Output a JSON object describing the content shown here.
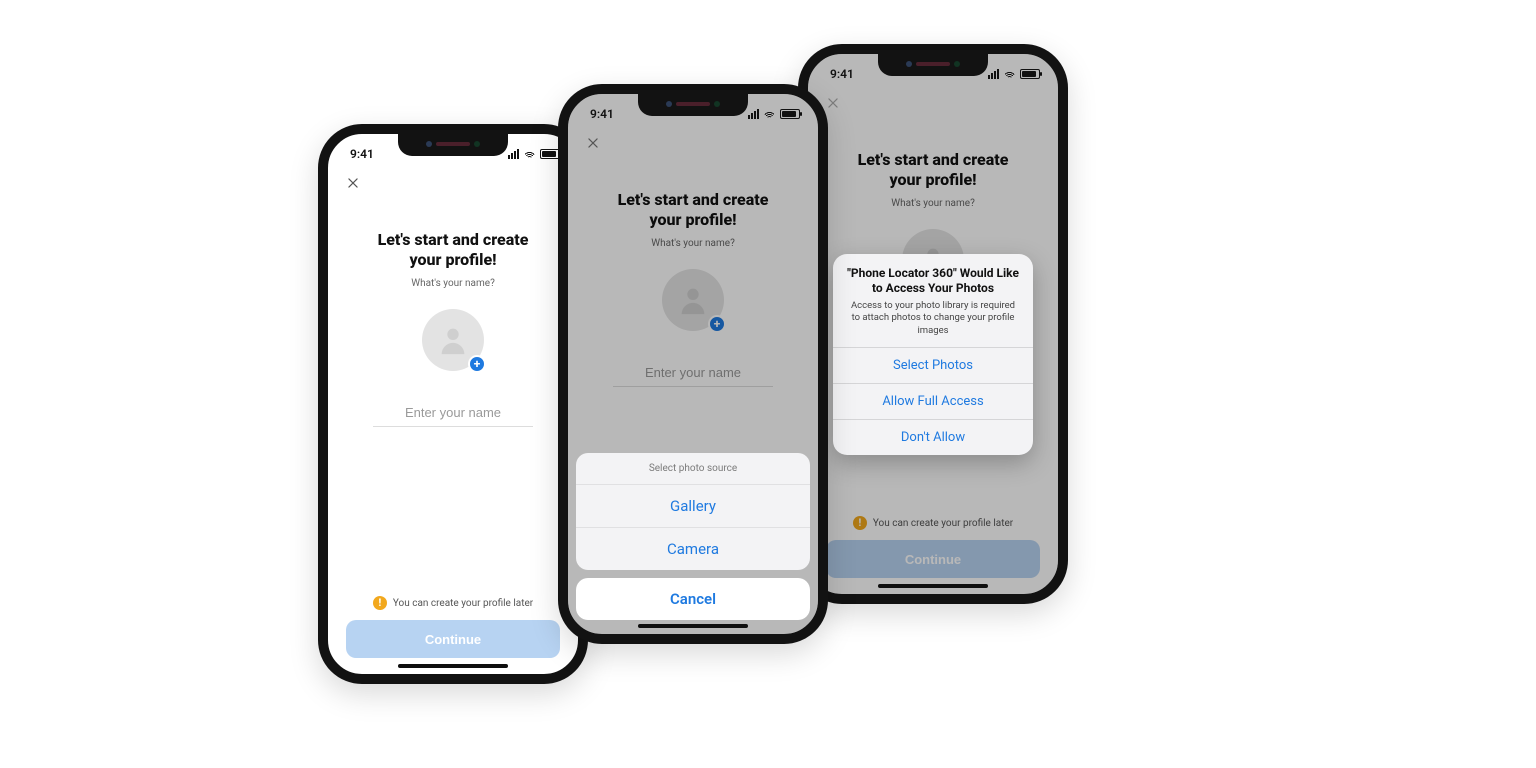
{
  "status": {
    "time": "9:41"
  },
  "profile": {
    "title_line1": "Let's start and create",
    "title_line2": "your profile!",
    "subtitle": "What's your name?",
    "name_placeholder": "Enter your name",
    "later_text": "You can create your profile later",
    "continue_label": "Continue"
  },
  "action_sheet": {
    "title": "Select photo source",
    "option_gallery": "Gallery",
    "option_camera": "Camera",
    "cancel": "Cancel"
  },
  "permission_alert": {
    "title": "\"Phone Locator 360\" Would Like to Access Your Photos",
    "message": "Access to your photo library is required to attach photos to change your profile images",
    "select_photos": "Select Photos",
    "allow_full": "Allow Full Access",
    "dont_allow": "Don't Allow"
  }
}
